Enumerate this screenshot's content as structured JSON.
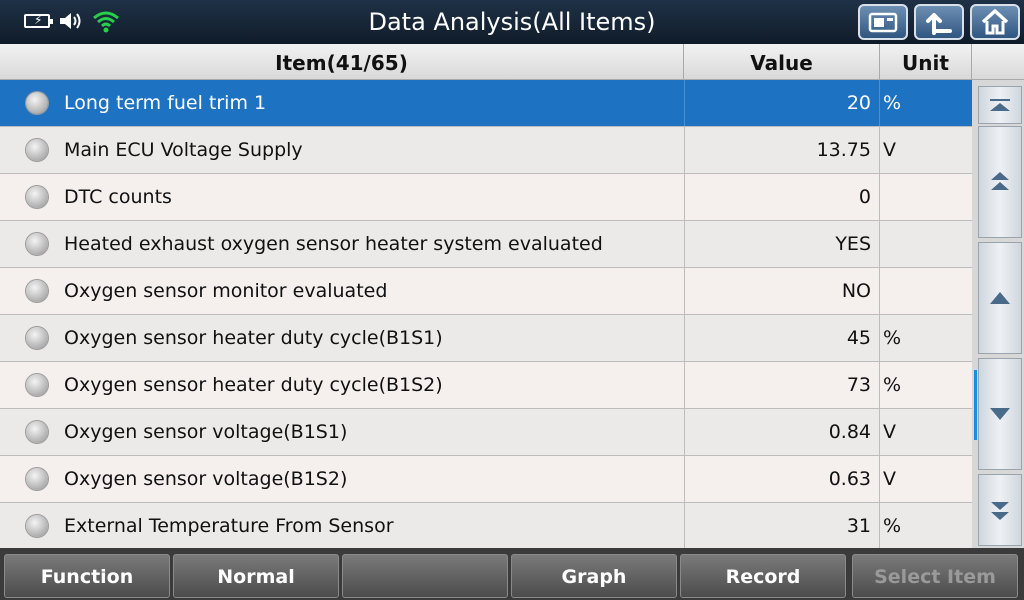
{
  "header": {
    "title": "Data Analysis(All Items)"
  },
  "status_icons": [
    "battery-icon",
    "speaker-icon",
    "wifi-icon"
  ],
  "toolbar_icons": [
    "screenshot-icon",
    "back-arrow-icon",
    "home-icon"
  ],
  "table": {
    "columns": [
      "Item(41/65)",
      "Value",
      "Unit"
    ],
    "rows": [
      {
        "name": "Long term fuel trim 1",
        "value": "20",
        "unit": "%"
      },
      {
        "name": "Main ECU Voltage Supply",
        "value": "13.75",
        "unit": "V"
      },
      {
        "name": "DTC counts",
        "value": "0",
        "unit": ""
      },
      {
        "name": "Heated exhaust oxygen sensor heater system evaluated",
        "value": "YES",
        "unit": ""
      },
      {
        "name": "Oxygen sensor monitor evaluated",
        "value": "NO",
        "unit": ""
      },
      {
        "name": "Oxygen sensor heater duty cycle(B1S1)",
        "value": "45",
        "unit": "%"
      },
      {
        "name": "Oxygen sensor heater duty cycle(B1S2)",
        "value": "73",
        "unit": "%"
      },
      {
        "name": "Oxygen sensor voltage(B1S1)",
        "value": "0.84",
        "unit": "V"
      },
      {
        "name": "Oxygen sensor voltage(B1S2)",
        "value": "0.63",
        "unit": "V"
      },
      {
        "name": "External Temperature From Sensor",
        "value": "31",
        "unit": "%"
      }
    ]
  },
  "bottom": {
    "function": "Function",
    "normal": "Normal",
    "blank": "",
    "graph": "Graph",
    "record": "Record",
    "select_item": "Select Item"
  },
  "colors": {
    "selected_row": "#1e72c2",
    "scroll_thumb": "#1a8fe0"
  }
}
